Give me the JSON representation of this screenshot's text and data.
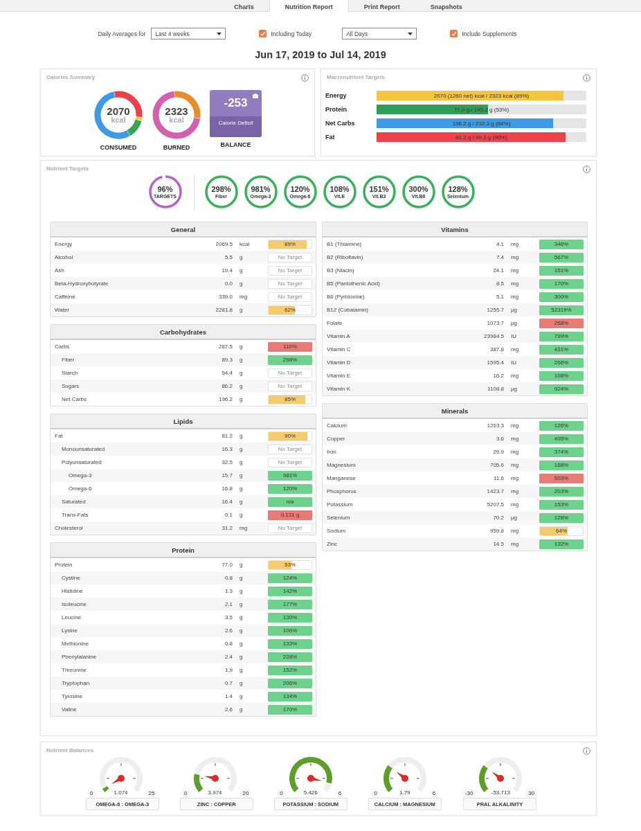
{
  "tabs": [
    {
      "label": "Charts",
      "selected": false
    },
    {
      "label": "Nutrition Report",
      "selected": true
    },
    {
      "label": "Print Report",
      "selected": false
    },
    {
      "label": "Snapshots",
      "selected": false
    }
  ],
  "controls": [
    {
      "kind": "label",
      "text": "Daily Averages for"
    },
    {
      "kind": "select",
      "value": "Last 4 weeks"
    },
    {
      "kind": "checkbox",
      "label": "Including Today",
      "checked": true
    },
    {
      "kind": "select",
      "value": "All Days"
    },
    {
      "kind": "checkbox",
      "label": "Include Supplements",
      "checked": true
    }
  ],
  "date_range": "Jun 17, 2019 to Jul 14, 2019",
  "calories_summary": {
    "title": "Calories Summary",
    "consumed": {
      "value": "2070",
      "unit": "kcal",
      "label": "CONSUMED"
    },
    "burned": {
      "value": "2323",
      "unit": "kcal",
      "label": "BURNED"
    },
    "balance": {
      "value": "-253",
      "caption": "Calorie Deficit",
      "label": "BALANCE"
    }
  },
  "macronutrient_targets": {
    "title": "Macronutrient Targets",
    "rows": [
      {
        "label": "Energy",
        "text": "2070 (1260 net) kcal / 2323 kcal (89%)",
        "level": 0.89,
        "color": "#f5c53f"
      },
      {
        "label": "Protein",
        "text": "77.0 g / 145.2 g (53%)",
        "level": 0.53,
        "color": "#2e9f55"
      },
      {
        "label": "Net Carbs",
        "text": "196.2 g / 232.3 g (84%)",
        "level": 0.84,
        "color": "#3d9be6"
      },
      {
        "label": "Fat",
        "text": "81.2 g / 90.3 g (90%)",
        "level": 0.9,
        "color": "#ea444c"
      }
    ]
  },
  "nutrient_targets": {
    "title": "Nutrient Targets",
    "rings": [
      {
        "kind": "summary",
        "value": "96%",
        "label": "TARGETS",
        "level": 0.96
      },
      {
        "kind": "nutrient",
        "value": "298%",
        "label": "Fiber",
        "level": 1
      },
      {
        "kind": "nutrient",
        "value": "981%",
        "label": "Omega-3",
        "level": 1
      },
      {
        "kind": "nutrient",
        "value": "120%",
        "label": "Omega-6",
        "level": 1
      },
      {
        "kind": "nutrient",
        "value": "108%",
        "label": "Vit.E",
        "level": 1
      },
      {
        "kind": "nutrient",
        "value": "151%",
        "label": "Vit.B3",
        "level": 1
      },
      {
        "kind": "nutrient",
        "value": "300%",
        "label": "Vit.B6",
        "level": 1
      },
      {
        "kind": "nutrient",
        "value": "128%",
        "label": "Selenium",
        "level": 1
      }
    ],
    "columns": [
      {
        "sections": [
          {
            "title": "General",
            "rows": [
              {
                "name": "Energy",
                "amount": "2069.5",
                "unit": "kcal",
                "kind": "under",
                "target": "89%",
                "level": 0.89
              },
              {
                "name": "Alcohol",
                "amount": "5.5",
                "unit": "g",
                "kind": "none",
                "target": "No Target"
              },
              {
                "name": "Ash",
                "amount": "19.4",
                "unit": "g",
                "kind": "none",
                "target": "No Target"
              },
              {
                "name": "Beta-Hydroxybutyrate",
                "amount": "0.0",
                "unit": "g",
                "kind": "none",
                "target": "No Target"
              },
              {
                "name": "Caffeine",
                "amount": "339.0",
                "unit": "mg",
                "kind": "none",
                "target": "No Target"
              },
              {
                "name": "Water",
                "amount": "2281.8",
                "unit": "g",
                "kind": "under",
                "target": "62%",
                "level": 0.62
              }
            ]
          },
          {
            "title": "Carbohydrates",
            "rows": [
              {
                "name": "Carbs",
                "amount": "287.5",
                "unit": "g",
                "kind": "over",
                "target": "110%",
                "children": [
                  {
                    "name": "Fiber",
                    "amount": "89.3",
                    "unit": "g",
                    "kind": "ok",
                    "target": "298%"
                  },
                  {
                    "name": "Starch",
                    "amount": "54.4",
                    "unit": "g",
                    "kind": "none",
                    "target": "No Target"
                  },
                  {
                    "name": "Sugars",
                    "amount": "86.2",
                    "unit": "g",
                    "kind": "none",
                    "target": "No Target"
                  },
                  {
                    "name": "Net Carbs",
                    "amount": "196.2",
                    "unit": "g",
                    "kind": "under",
                    "target": "85%",
                    "level": 0.85
                  }
                ]
              }
            ]
          },
          {
            "title": "Lipids",
            "rows": [
              {
                "name": "Fat",
                "amount": "81.2",
                "unit": "g",
                "kind": "under",
                "target": "90%",
                "level": 0.9,
                "children": [
                  {
                    "name": "Monounsaturated",
                    "amount": "16.3",
                    "unit": "g",
                    "kind": "none",
                    "target": "No Target"
                  },
                  {
                    "name": "Polyunsaturated",
                    "amount": "32.5",
                    "unit": "g",
                    "kind": "none",
                    "target": "No Target",
                    "children": [
                      {
                        "name": "Omega-3",
                        "amount": "15.7",
                        "unit": "g",
                        "kind": "ok",
                        "target": "981%"
                      },
                      {
                        "name": "Omega-6",
                        "amount": "16.8",
                        "unit": "g",
                        "kind": "ok",
                        "target": "120%"
                      }
                    ]
                  },
                  {
                    "name": "Saturated",
                    "amount": "16.4",
                    "unit": "g",
                    "kind": "ok",
                    "target": "n/a"
                  },
                  {
                    "name": "Trans-Fats",
                    "amount": "0.1",
                    "unit": "g",
                    "kind": "over",
                    "target": "0.131 g"
                  }
                ]
              },
              {
                "name": "Cholesterol",
                "amount": "31.2",
                "unit": "mg",
                "kind": "none",
                "target": "No Target"
              }
            ]
          },
          {
            "title": "Protein",
            "rows": [
              {
                "name": "Protein",
                "amount": "77.0",
                "unit": "g",
                "kind": "under",
                "target": "53%",
                "level": 0.53,
                "children": [
                  {
                    "name": "Cystine",
                    "amount": "0.8",
                    "unit": "g",
                    "kind": "ok",
                    "target": "124%"
                  },
                  {
                    "name": "Histidine",
                    "amount": "1.3",
                    "unit": "g",
                    "kind": "ok",
                    "target": "142%"
                  },
                  {
                    "name": "Isoleucine",
                    "amount": "2.1",
                    "unit": "g",
                    "kind": "ok",
                    "target": "177%"
                  },
                  {
                    "name": "Leucine",
                    "amount": "3.5",
                    "unit": "g",
                    "kind": "ok",
                    "target": "130%"
                  },
                  {
                    "name": "Lysine",
                    "amount": "2.6",
                    "unit": "g",
                    "kind": "ok",
                    "target": "106%"
                  },
                  {
                    "name": "Methionine",
                    "amount": "0.8",
                    "unit": "g",
                    "kind": "ok",
                    "target": "133%"
                  },
                  {
                    "name": "Phenylalanine",
                    "amount": "2.4",
                    "unit": "g",
                    "kind": "ok",
                    "target": "228%"
                  },
                  {
                    "name": "Threonine",
                    "amount": "1.9",
                    "unit": "g",
                    "kind": "ok",
                    "target": "152%"
                  },
                  {
                    "name": "Tryptophan",
                    "amount": "0.7",
                    "unit": "g",
                    "kind": "ok",
                    "target": "206%"
                  },
                  {
                    "name": "Tyrosine",
                    "amount": "1.4",
                    "unit": "g",
                    "kind": "ok",
                    "target": "134%"
                  },
                  {
                    "name": "Valine",
                    "amount": "2.6",
                    "unit": "g",
                    "kind": "ok",
                    "target": "170%"
                  }
                ]
              }
            ]
          }
        ]
      },
      {
        "sections": [
          {
            "title": "Vitamins",
            "rows": [
              {
                "name": "B1 (Thiamine)",
                "amount": "4.1",
                "unit": "mg",
                "kind": "ok",
                "target": "346%"
              },
              {
                "name": "B2 (Riboflavin)",
                "amount": "7.4",
                "unit": "mg",
                "kind": "ok",
                "target": "567%"
              },
              {
                "name": "B3 (Niacin)",
                "amount": "24.1",
                "unit": "mg",
                "kind": "ok",
                "target": "151%"
              },
              {
                "name": "B5 (Pantothenic Acid)",
                "amount": "8.5",
                "unit": "mg",
                "kind": "ok",
                "target": "170%"
              },
              {
                "name": "B6 (Pyridoxine)",
                "amount": "5.1",
                "unit": "mg",
                "kind": "ok",
                "target": "300%"
              },
              {
                "name": "B12 (Cobalamin)",
                "amount": "1255.7",
                "unit": "µg",
                "kind": "ok",
                "target": "52319%"
              },
              {
                "name": "Folate",
                "amount": "1073.7",
                "unit": "µg",
                "kind": "over",
                "target": "268%"
              },
              {
                "name": "Vitamin A",
                "amount": "23984.5",
                "unit": "IU",
                "kind": "ok",
                "target": "799%"
              },
              {
                "name": "Vitamin C",
                "amount": "387.8",
                "unit": "mg",
                "kind": "ok",
                "target": "431%"
              },
              {
                "name": "Vitamin D",
                "amount": "1595.4",
                "unit": "IU",
                "kind": "ok",
                "target": "266%"
              },
              {
                "name": "Vitamin E",
                "amount": "16.2",
                "unit": "mg",
                "kind": "ok",
                "target": "108%"
              },
              {
                "name": "Vitamin K",
                "amount": "1108.8",
                "unit": "µg",
                "kind": "ok",
                "target": "924%"
              }
            ]
          },
          {
            "title": "Minerals",
            "rows": [
              {
                "name": "Calcium",
                "amount": "1263.3",
                "unit": "mg",
                "kind": "ok",
                "target": "126%"
              },
              {
                "name": "Copper",
                "amount": "3.6",
                "unit": "mg",
                "kind": "ok",
                "target": "405%"
              },
              {
                "name": "Iron",
                "amount": "29.9",
                "unit": "mg",
                "kind": "ok",
                "target": "374%"
              },
              {
                "name": "Magnesium",
                "amount": "705.6",
                "unit": "mg",
                "kind": "ok",
                "target": "168%"
              },
              {
                "name": "Manganese",
                "amount": "11.6",
                "unit": "mg",
                "kind": "over",
                "target": "503%"
              },
              {
                "name": "Phosphorus",
                "amount": "1423.7",
                "unit": "mg",
                "kind": "ok",
                "target": "203%"
              },
              {
                "name": "Potassium",
                "amount": "5207.5",
                "unit": "mg",
                "kind": "ok",
                "target": "153%"
              },
              {
                "name": "Selenium",
                "amount": "70.2",
                "unit": "µg",
                "kind": "ok",
                "target": "128%"
              },
              {
                "name": "Sodium",
                "amount": "959.8",
                "unit": "mg",
                "kind": "under",
                "target": "64%",
                "level": 0.64
              },
              {
                "name": "Zinc",
                "amount": "14.5",
                "unit": "mg",
                "kind": "ok",
                "target": "132%"
              }
            ]
          }
        ]
      }
    ]
  },
  "nutrient_balances": {
    "title": "Nutrient Balances",
    "gauges": [
      {
        "min": "0",
        "max": "25",
        "value": "1.074",
        "label": "OMEGA-6 : OMEGA-3"
      },
      {
        "min": "0",
        "max": "20",
        "value": "3.974",
        "label": "ZINC : COPPER"
      },
      {
        "min": "0",
        "max": "6",
        "value": "5.426",
        "label": "POTASSIUM : SODIUM"
      },
      {
        "min": "0",
        "max": "6",
        "value": "1.79",
        "label": "CALCIUM : MAGNESIUM"
      },
      {
        "min": "-30",
        "max": "30",
        "value": "-53.713",
        "label": "PRAL ALKALINITY"
      }
    ]
  }
}
